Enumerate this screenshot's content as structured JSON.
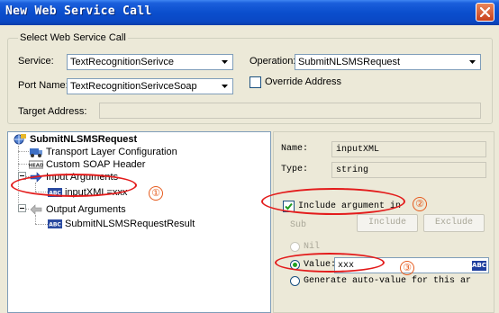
{
  "window": {
    "title": "New Web Service Call"
  },
  "group": {
    "legend": "Select Web Service Call",
    "service_label": "Service:",
    "service_value": "TextRecognitionSerivce",
    "port_label": "Port Name:",
    "port_value": "TextRecognitionSerivceSoap",
    "operation_label": "Operation:",
    "operation_value": "SubmitNLSMSRequest",
    "override_label": "Override Address",
    "override_checked": false,
    "target_label": "Target Address:",
    "target_value": ""
  },
  "tree": {
    "root": "SubmitNLSMSRequest",
    "items": [
      {
        "label": "Transport Layer Configuration",
        "icon": "transport-icon"
      },
      {
        "label": "Custom SOAP Header",
        "icon": "head-icon"
      },
      {
        "label": "Input Arguments",
        "icon": "input-arrow-icon"
      },
      {
        "label": "inputXML=xxx",
        "icon": "abc-icon",
        "selected": true
      },
      {
        "label": "Output Arguments",
        "icon": "output-arrow-icon"
      },
      {
        "label": "SubmitNLSMSRequestResult",
        "icon": "abc-icon"
      }
    ]
  },
  "details": {
    "name_label": "Name:",
    "name_value": "inputXML",
    "type_label": "Type:",
    "type_value": "string",
    "include_label": "Include argument in",
    "include_checked": true,
    "sub_label": "Sub",
    "include_button": "Include",
    "exclude_button": "Exclude",
    "nil_label": "Nil",
    "value_label": "Value:",
    "value_text": "xxx",
    "value_badge": "ABC",
    "generate_label": "Generate auto-value for this ar"
  },
  "annotations": {
    "marker1": "①",
    "marker2": "②",
    "marker3": "③"
  },
  "colors": {
    "titlebar": "#0a4ecd",
    "dialog_bg": "#ece9d8",
    "annotation_red": "#e31b1b",
    "marker_orange": "#e65b1e"
  }
}
